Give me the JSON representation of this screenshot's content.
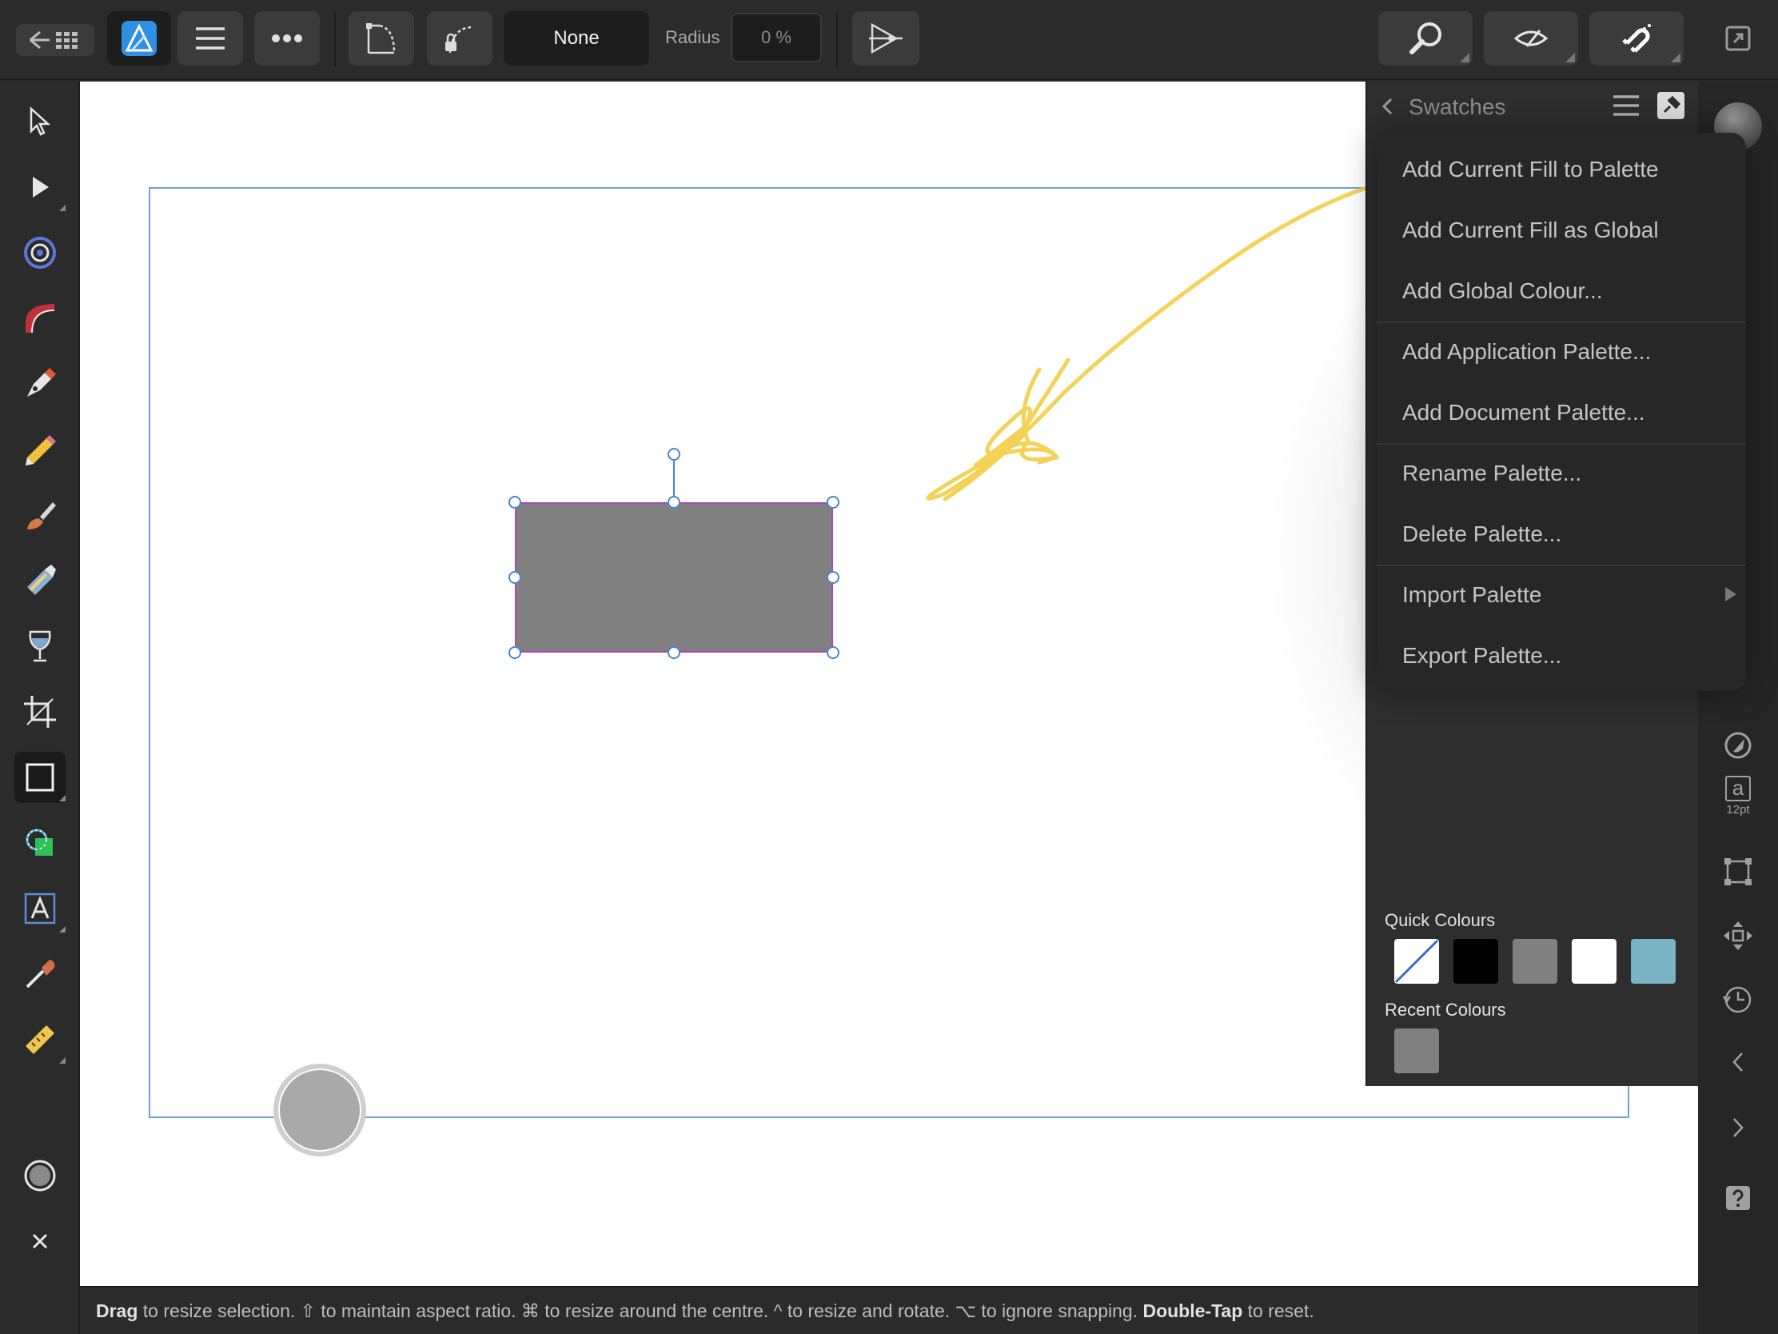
{
  "toolbar": {
    "fill_style_value": "None",
    "radius_label": "Radius",
    "radius_value": "0 %"
  },
  "panel": {
    "title": "Swatches",
    "quick_colours_label": "Quick Colours",
    "recent_colours_label": "Recent Colours",
    "quick_colours": [
      "none",
      "#000000",
      "#808080",
      "#ffffff",
      "#78b4c4"
    ],
    "recent_colours": [
      "#808080"
    ]
  },
  "menu": {
    "items": [
      "Add Current Fill to Palette",
      "Add Current Fill as Global",
      "Add Global Colour...",
      "Add Application Palette...",
      "Add Document Palette...",
      "Rename Palette...",
      "Delete Palette...",
      "Import Palette",
      "Export Palette..."
    ]
  },
  "right_strip": {
    "font_size_label": "12pt",
    "text_glyph": "a"
  },
  "status": {
    "s1": "Drag",
    "s2": " to resize selection. ⇧ to maintain aspect ratio. ⌘ to resize around the centre. ^ to resize and rotate. ⌥ to ignore snapping. ",
    "s3": "Double-Tap",
    "s4": " to reset."
  },
  "colors": {
    "accent": "#4a86cc",
    "selection_outline": "#b043c0",
    "shape_fill": "#808080",
    "annotation_stroke": "#f3cf4a"
  }
}
